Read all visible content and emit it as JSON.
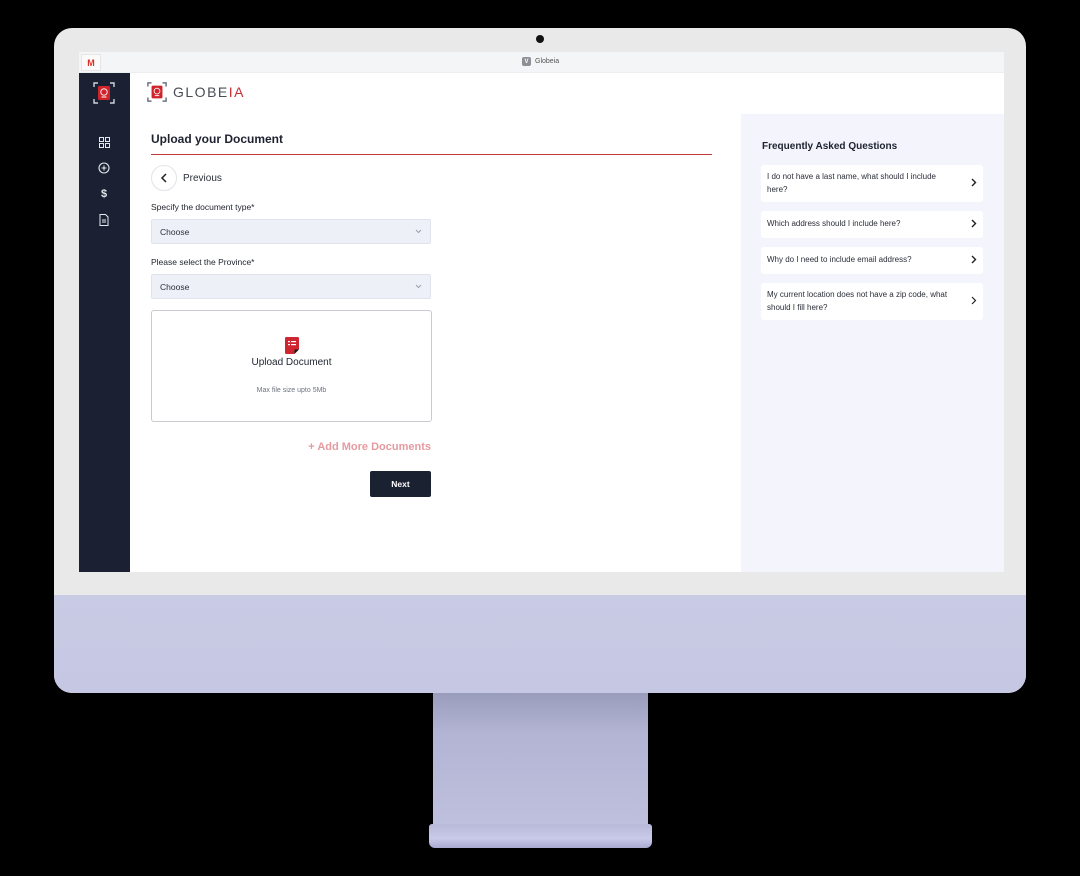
{
  "browser": {
    "tab_favicon": "M",
    "title": "Globeia",
    "title_icon": "V"
  },
  "brand": {
    "name_main": "GLOBE",
    "name_accent": "IA",
    "accent_color": "#c62d33"
  },
  "sidebar": {
    "items": [
      {
        "name": "dashboard",
        "icon": "grid-icon",
        "glyph": "⊞"
      },
      {
        "name": "add",
        "icon": "plus-circle-icon",
        "glyph": "⊕"
      },
      {
        "name": "payments",
        "icon": "dollar-icon",
        "glyph": "$"
      },
      {
        "name": "documents",
        "icon": "document-icon",
        "glyph": "🗎"
      }
    ]
  },
  "main": {
    "title": "Upload your Document",
    "previous_label": "Previous",
    "previous_icon": "‹",
    "document_type": {
      "label": "Specify the document type*",
      "value": "Choose"
    },
    "province": {
      "label": "Please select the Province*",
      "value": "Choose"
    },
    "chevron_glyph": "⌄",
    "upload": {
      "title": "Upload Document",
      "subtitle": "Max file size upto 5Mb"
    },
    "add_more_label": "+ Add More Documents",
    "next_label": "Next"
  },
  "faq": {
    "title": "Frequently Asked Questions",
    "chevron_glyph": "›",
    "items": [
      {
        "question": "I do not have a last name, what should I include here?"
      },
      {
        "question": "Which address should I include here?"
      },
      {
        "question": "Why do I need to include email address?"
      },
      {
        "question": "My current location does not have a zip code, what should I fill here?"
      }
    ]
  },
  "colors": {
    "sidebar_bg": "#1b2132",
    "primary_button": "#1a2130",
    "accent_red": "#c9383d",
    "add_more_pink": "#e59aa0",
    "faq_bg": "#f3f4fc"
  }
}
